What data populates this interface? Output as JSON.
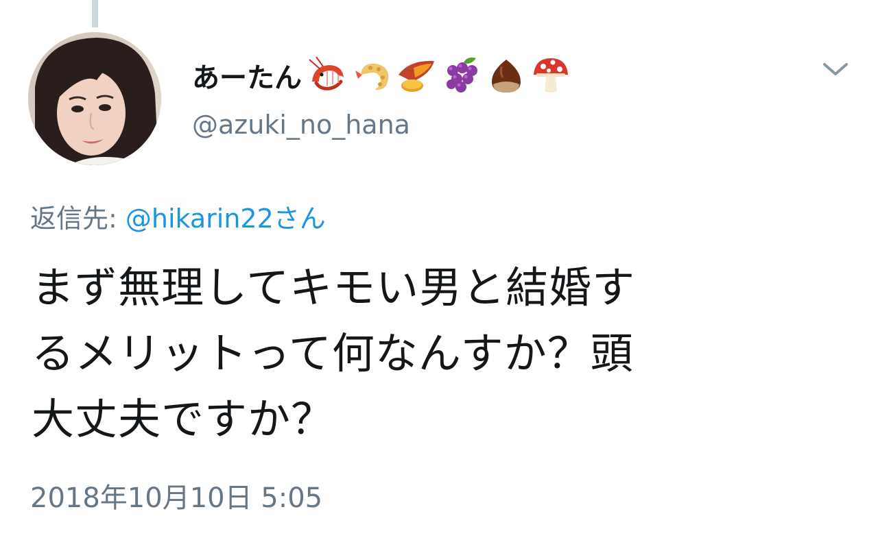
{
  "tweet": {
    "display_name": "あーたん",
    "name_emojis": [
      "shrimp-emoji",
      "fried-shrimp-emoji",
      "sweet-potato-emoji",
      "grapes-emoji",
      "chestnut-emoji",
      "mushroom-emoji"
    ],
    "handle": "@azuki_no_hana",
    "reply_prefix": "返信先: ",
    "reply_target": "@hikarin22さん",
    "text_lines": [
      "まず無理してキモい男と結婚す",
      "るメリットって何なんすか？頭",
      "大丈夫ですか？"
    ],
    "timestamp": "2018年10月10日 5:05"
  },
  "colors": {
    "primary_text": "#14171a",
    "secondary_text": "#657786",
    "link": "#1b95e0",
    "thread_line": "#ccd6dd"
  },
  "icons": {
    "menu": "chevron-down-icon"
  }
}
